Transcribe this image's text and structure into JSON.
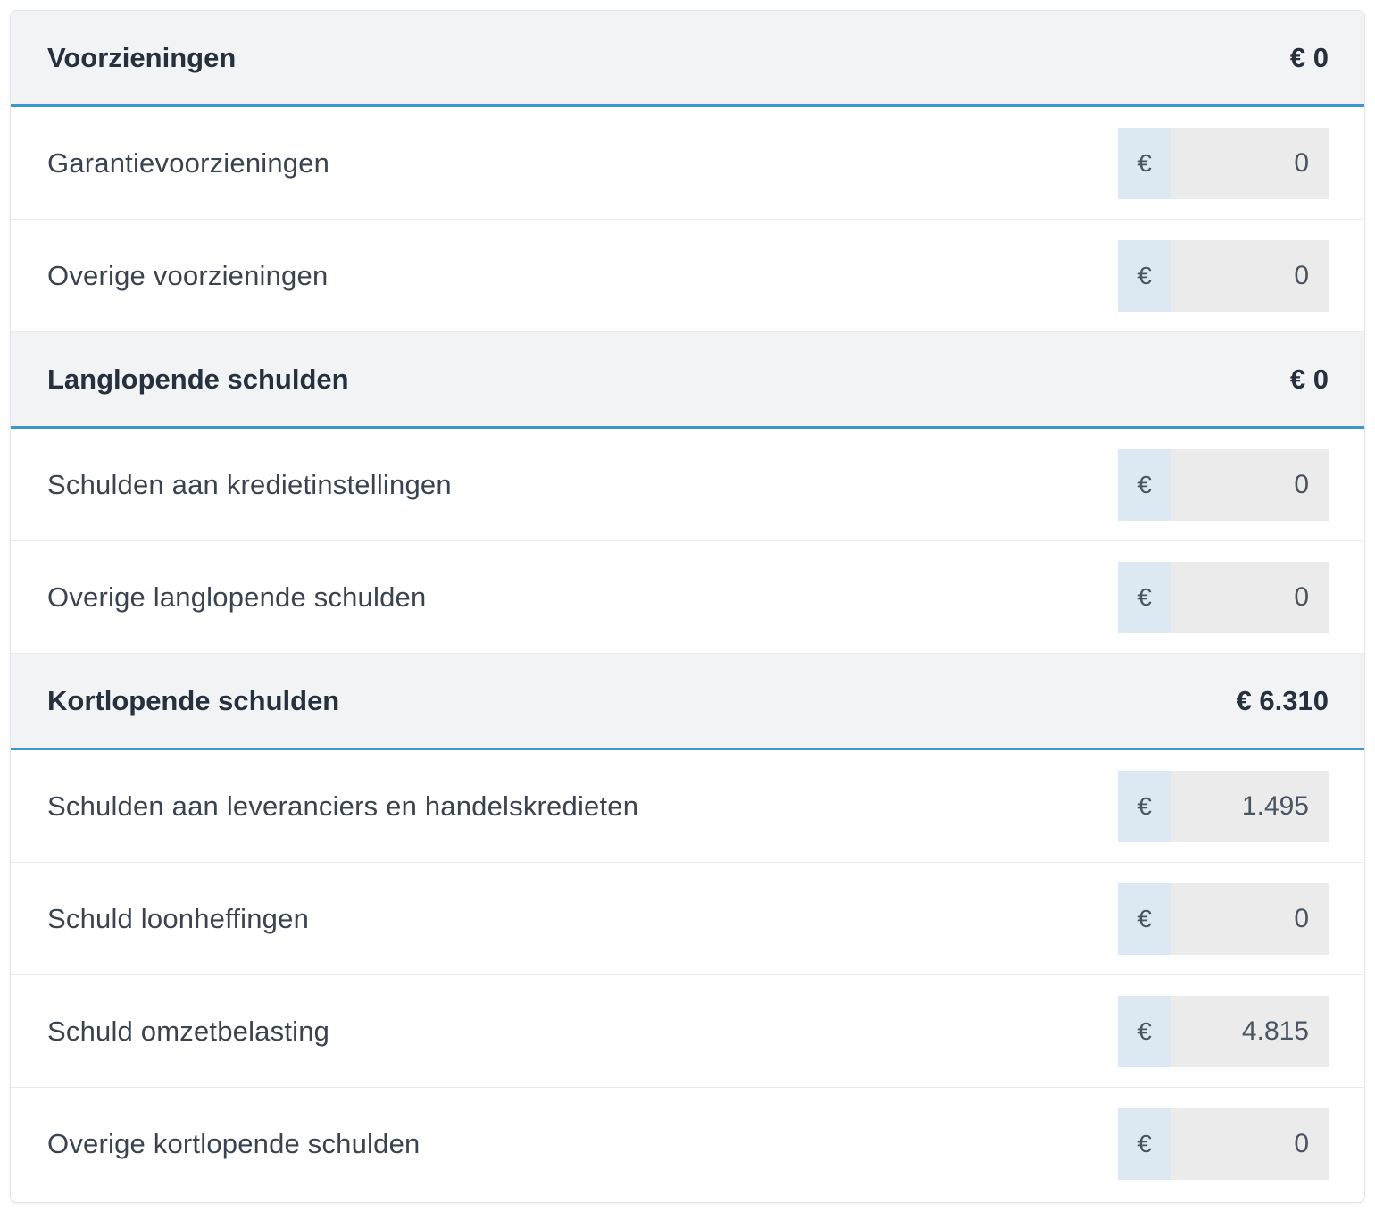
{
  "currency_symbol": "€",
  "sections": [
    {
      "title": "Voorzieningen",
      "total": "€ 0",
      "rows": [
        {
          "label": "Garantievoorzieningen",
          "value": "0"
        },
        {
          "label": "Overige voorzieningen",
          "value": "0"
        }
      ]
    },
    {
      "title": "Langlopende schulden",
      "total": "€ 0",
      "rows": [
        {
          "label": "Schulden aan kredietinstellingen",
          "value": "0"
        },
        {
          "label": "Overige langlopende schulden",
          "value": "0"
        }
      ]
    },
    {
      "title": "Kortlopende schulden",
      "total": "€ 6.310",
      "rows": [
        {
          "label": "Schulden aan leveranciers en handelskredieten",
          "value": "1.495"
        },
        {
          "label": "Schuld loonheffingen",
          "value": "0"
        },
        {
          "label": "Schuld omzetbelasting",
          "value": "4.815"
        },
        {
          "label": "Overige kortlopende schulden",
          "value": "0"
        }
      ]
    }
  ],
  "colors": {
    "header_bg": "#f1f3f5",
    "accent_border": "#3d98cd",
    "currency_bg": "#dce9f2",
    "value_bg": "#ebebeb"
  }
}
